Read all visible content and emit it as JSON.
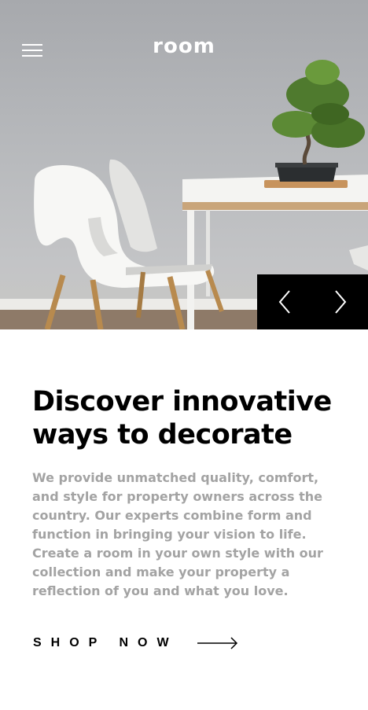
{
  "header": {
    "logo_text": "room",
    "menu_icon": "hamburger-menu-icon"
  },
  "hero": {
    "image_description_icon": "hero-image",
    "prev_icon": "chevron-left-icon",
    "next_icon": "chevron-right-icon"
  },
  "main": {
    "headline_line1": "Discover innovative",
    "headline_line2": "ways to decorate",
    "description": "We provide unmatched quality, comfort, and style for property owners across the country. Our experts combine form and function in bringing your vision to life. Create a room in your own style with our collection and make your property a reflection of you and what you love.",
    "cta_label": "SHOP NOW",
    "cta_icon": "arrow-right-icon"
  },
  "colors": {
    "text_primary": "#000000",
    "text_secondary": "#a3a3a3",
    "control_bg": "#000000",
    "control_fg": "#ffffff"
  }
}
